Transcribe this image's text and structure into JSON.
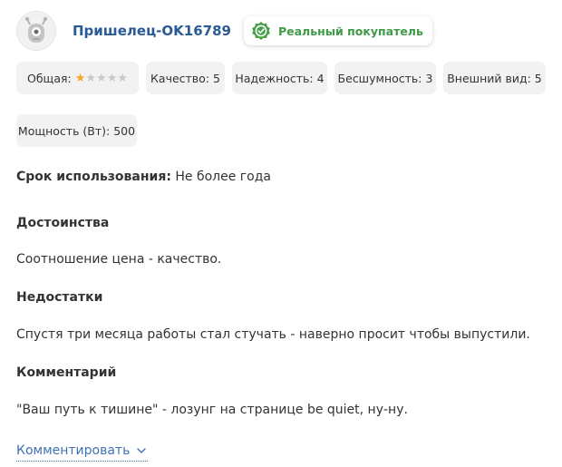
{
  "author": {
    "name": "Пришелец-OK16789"
  },
  "badge": {
    "label": "Реальный покупатель"
  },
  "ratings": {
    "overall_label": "Общая:",
    "overall_stars": 1,
    "max_stars": 5,
    "items": [
      "Качество: 5",
      "Надежность: 4",
      "Бесшумность: 3",
      "Внешний вид: 5",
      "Мощность (Вт): 500"
    ]
  },
  "usage": {
    "label": "Срок использования:",
    "value": "Не более года"
  },
  "pros": {
    "title": "Достоинства",
    "text": "Соотношение цена - качество."
  },
  "cons": {
    "title": "Недостатки",
    "text": "Спустя три месяца работы стал стучать - наверно просит чтобы выпустили."
  },
  "comment": {
    "title": "Комментарий",
    "text": "\"Ваш путь к тишине\" - лозунг на странице be quiet, ну-ну."
  },
  "actions": {
    "comment_label": "Комментировать"
  },
  "colors": {
    "link": "#2a5a98",
    "verified": "#3f9a47",
    "star_filled": "#f5a623",
    "star_empty": "#c8c8c8",
    "chip_bg": "#f2f2f2"
  },
  "icons": {
    "avatar": "alien-avatar-icon",
    "badge": "verified-check-icon",
    "expand": "chevron-down-icon"
  }
}
